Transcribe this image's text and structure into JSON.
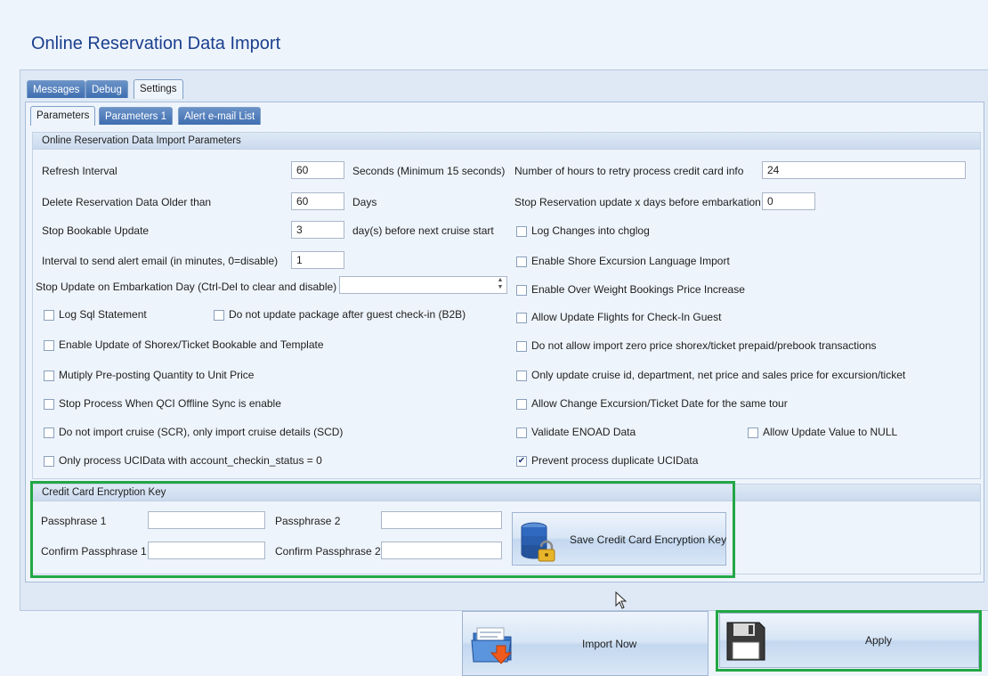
{
  "window": {
    "title": "Online Reservation Data Import"
  },
  "tabs": {
    "top": [
      {
        "label": "Messages"
      },
      {
        "label": "Debug"
      },
      {
        "label": "Settings"
      }
    ],
    "sub": [
      {
        "label": "Parameters"
      },
      {
        "label": "Parameters 1"
      },
      {
        "label": "Alert e-mail List"
      }
    ]
  },
  "params_group": {
    "title": "Online Reservation Data Import Parameters",
    "refresh_interval": {
      "label": "Refresh Interval",
      "value": "60",
      "unit": "Seconds (Minimum 15 seconds)"
    },
    "delete_older": {
      "label": "Delete Reservation Data Older than",
      "value": "60",
      "unit": "Days"
    },
    "stop_bookable": {
      "label": "Stop Bookable Update",
      "value": "3",
      "unit": "day(s) before next cruise start"
    },
    "alert_interval": {
      "label": "Interval to send alert email (in minutes, 0=disable)",
      "value": "1"
    },
    "stop_embark_day": {
      "label": "Stop Update on Embarkation Day (Ctrl-Del to clear and disable)",
      "value": ""
    },
    "retry_hours": {
      "label": "Number of hours to retry process credit card info",
      "value": "24"
    },
    "stop_reservation": {
      "label": "Stop Reservation update x days before embarkation",
      "value": "0"
    },
    "left_checkboxes": [
      {
        "label": "Log Sql Statement",
        "checked": false
      },
      {
        "label": "Enable Update of Shorex/Ticket Bookable and Template",
        "checked": false
      },
      {
        "label": "Mutiply Pre-posting Quantity to Unit Price",
        "checked": false
      },
      {
        "label": "Stop Process When QCI Offline Sync is enable",
        "checked": false
      },
      {
        "label": "Do not import cruise (SCR), only import cruise details (SCD)",
        "checked": false
      },
      {
        "label": "Only process UCIData with account_checkin_status  = 0",
        "checked": false
      }
    ],
    "package_checkbox": {
      "label": "Do not update package after guest check-in (B2B)",
      "checked": false
    },
    "right_checkboxes": [
      {
        "label": "Log Changes into chglog",
        "checked": false
      },
      {
        "label": "Enable Shore Excursion Language Import",
        "checked": false
      },
      {
        "label": "Enable Over Weight Bookings Price Increase",
        "checked": false
      },
      {
        "label": "Allow Update Flights for Check-In Guest",
        "checked": false
      },
      {
        "label": "Do not allow import zero price shorex/ticket prepaid/prebook transactions",
        "checked": false
      },
      {
        "label": "Only update cruise id, department, net price and sales price for excursion/ticket",
        "checked": false
      },
      {
        "label": "Allow Change Excursion/Ticket Date for the same tour",
        "checked": false
      },
      {
        "label": "Validate ENOAD Data",
        "checked": false
      },
      {
        "label": "Prevent process duplicate UCIData",
        "checked": true
      }
    ],
    "null_checkbox": {
      "label": "Allow Update Value to NULL",
      "checked": false
    }
  },
  "cc_group": {
    "title": "Credit Card Encryption Key",
    "passphrase1": {
      "label": "Passphrase 1",
      "value": ""
    },
    "confirm1": {
      "label": "Confirm Passphrase 1",
      "value": ""
    },
    "passphrase2": {
      "label": "Passphrase 2",
      "value": ""
    },
    "confirm2": {
      "label": "Confirm Passphrase 2",
      "value": ""
    },
    "save_button": {
      "label": "Save Credit Card Encryption Key",
      "icon": "database-lock-icon"
    }
  },
  "footer": {
    "import_button": {
      "label": "Import Now",
      "icon": "import-folder-icon"
    },
    "apply_button": {
      "label": "Apply",
      "icon": "floppy-disk-icon"
    }
  },
  "colors": {
    "highlight": "#22a745",
    "title": "#1a3f8f",
    "tab_dark": "#3f6eb0"
  },
  "check_glyph": "✔"
}
